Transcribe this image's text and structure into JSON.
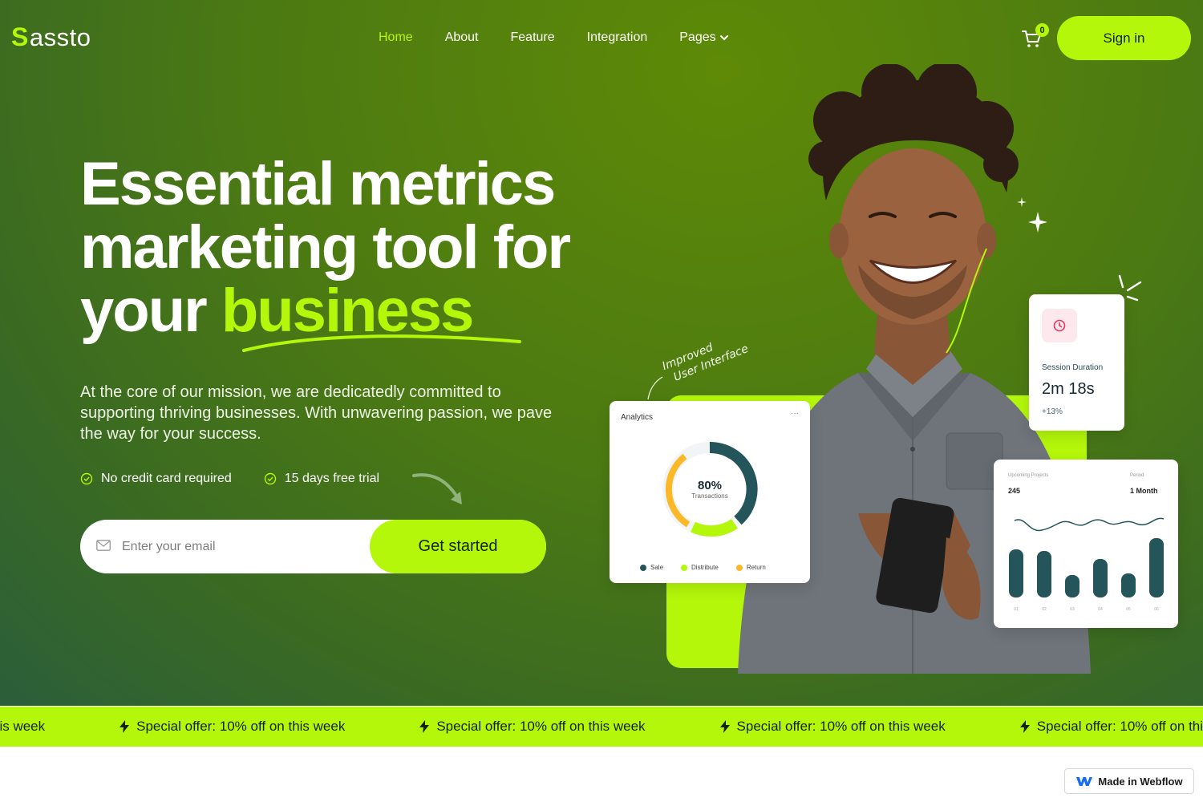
{
  "brand": {
    "name": "assto",
    "mark": "S"
  },
  "nav": {
    "items": [
      {
        "label": "Home",
        "active": true
      },
      {
        "label": "About"
      },
      {
        "label": "Feature"
      },
      {
        "label": "Integration"
      },
      {
        "label": "Pages"
      }
    ]
  },
  "cart": {
    "count": "0",
    "icon": "cart-icon"
  },
  "signin": {
    "label": "Sign in"
  },
  "hero": {
    "line1": "Essential metrics",
    "line2": "marketing tool for",
    "line3_plain": "your",
    "line3_accent": "business",
    "description": "At the core of our mission, we are dedicatedly committed to supporting thriving businesses. With unwavering passion, we pave the way for your success.",
    "checks": [
      "No credit card required",
      "15 days free trial"
    ],
    "email_placeholder": "Enter your email",
    "cta": "Get started",
    "annotation_line1": "Improved",
    "annotation_line2": "User Interface"
  },
  "analytics_card": {
    "title": "Analytics",
    "menu": "···",
    "value": "80%",
    "label": "Transactions",
    "legend": [
      {
        "label": "Sale",
        "color": "#23555a"
      },
      {
        "label": "Distribute",
        "color": "#b4f70a"
      },
      {
        "label": "Return",
        "color": "#fbb928"
      }
    ]
  },
  "session_card": {
    "label": "Session Duration",
    "value": "2m 18s",
    "delta": "+13%",
    "icon": "clock-icon"
  },
  "projects_card": {
    "label": "Upcoming Projects",
    "value": "245",
    "period_label": "Period",
    "period_value": "1 Month",
    "x_labels": [
      "01",
      "02",
      "03",
      "04",
      "05",
      "06"
    ]
  },
  "ticker": {
    "partial": "his week",
    "text": "Special offer: 10% off on this week",
    "icon": "lightning-icon"
  },
  "webflow_badge": {
    "label": "Made in Webflow"
  },
  "colors": {
    "accent": "#b4f70a",
    "dark_teal": "#23555a"
  }
}
